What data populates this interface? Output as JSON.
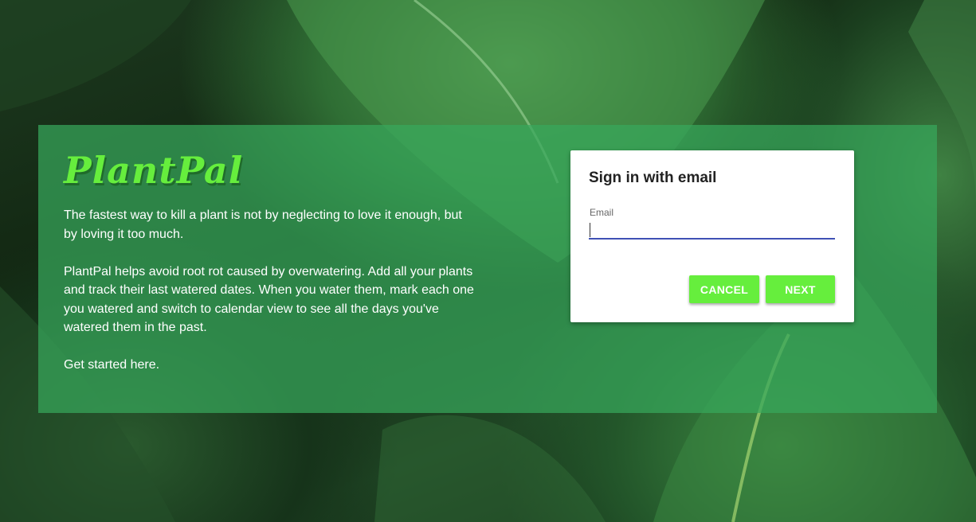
{
  "app": {
    "brand": "PlantPal"
  },
  "hero": {
    "paragraphs": [
      "The fastest way to kill a plant is not by neglecting to love it enough, but by loving it too much.",
      "PlantPal helps avoid root rot caused by overwatering. Add all your plants and track their last watered dates. When you water them, mark each one you watered and switch to calendar view to see all the days you've watered them in the past.",
      "Get started here."
    ]
  },
  "signin": {
    "title": "Sign in with email",
    "email_label": "Email",
    "email_value": "",
    "cancel_label": "CANCEL",
    "next_label": "NEXT"
  },
  "colors": {
    "brand_green": "#66ee3d",
    "panel_green": "#38a85c",
    "input_underline": "#3f51b5"
  }
}
